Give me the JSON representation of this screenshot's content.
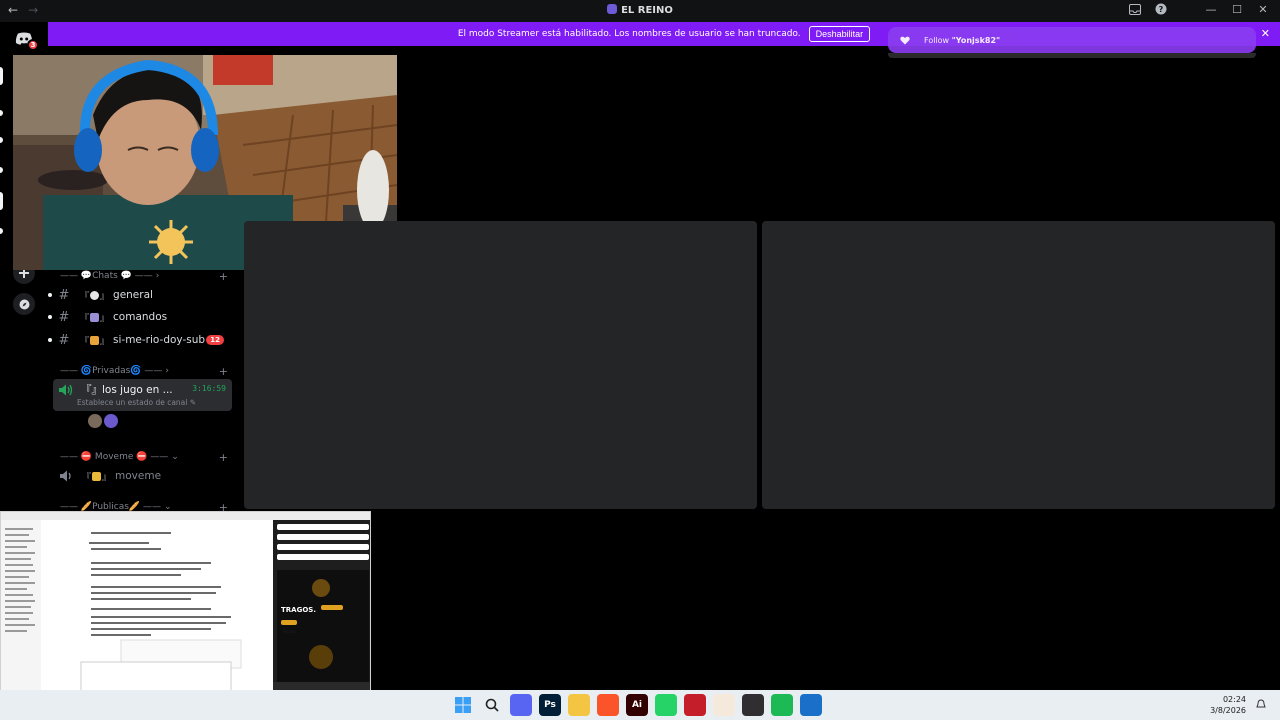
{
  "window": {
    "title": "EL REINO",
    "back_arrow": "←",
    "forward_arrow": "→",
    "minimize": "—",
    "maximize": "☐",
    "close": "✕"
  },
  "rail": {
    "notification_count": "3"
  },
  "banner": {
    "text": "El modo Streamer está habilitado. Los nombres de usuario se han truncado.",
    "button_label": "Deshabilitar",
    "close": "✕"
  },
  "toast": {
    "prefix": "Follow",
    "user": "\"Yonjsk82\""
  },
  "channels": {
    "categories": [
      {
        "label": "—— 💬Chats 💬 ——",
        "chevron": "›"
      },
      {
        "label": "—— 🌀Privadas🌀 ——",
        "chevron": "›"
      },
      {
        "label": "—— ⛔ Moveme ⛔ ——",
        "chevron": "⌄"
      },
      {
        "label": "—— 🥖Publicas🥖 ——",
        "chevron": "⌄"
      }
    ],
    "text_channels": [
      {
        "name": "general",
        "open": "『",
        "close": "』"
      },
      {
        "name": "comandos",
        "open": "『",
        "close": "』"
      },
      {
        "name": "si-me-rio-doy-sub",
        "open": "『",
        "close": "』",
        "mentions": "12"
      }
    ],
    "voice_active": {
      "name": "los jugo en ...",
      "open": "『",
      "close": "』",
      "timer": "3:16:59",
      "status": "Establece un estado de canal ✎"
    },
    "voice_moveme": {
      "name": "moveme",
      "open": "『",
      "close": "』"
    },
    "plus": "+"
  },
  "screen_capture": {
    "heading": "TRAGOS.",
    "promo_tag": "Promo"
  },
  "taskbar": {
    "time": "02:24",
    "date": "3/8/2026",
    "apps": [
      {
        "name": "windows-start",
        "label": "",
        "color": "#1f7ae0"
      },
      {
        "name": "search",
        "label": "",
        "color": "#e9eef2"
      },
      {
        "name": "discord",
        "label": "",
        "color": "#5865f2"
      },
      {
        "name": "photoshop",
        "label": "Ps",
        "color": "#001e36"
      },
      {
        "name": "file-explorer",
        "label": "",
        "color": "#f4c542"
      },
      {
        "name": "brave",
        "label": "",
        "color": "#fb542b"
      },
      {
        "name": "illustrator",
        "label": "Ai",
        "color": "#330000"
      },
      {
        "name": "whatsapp",
        "label": "",
        "color": "#25d366"
      },
      {
        "name": "video-editor",
        "label": "",
        "color": "#c41e2a"
      },
      {
        "name": "sun-app",
        "label": "",
        "color": "#f5e9dc"
      },
      {
        "name": "obs",
        "label": "",
        "color": "#302e31"
      },
      {
        "name": "spotify",
        "label": "",
        "color": "#1db954"
      },
      {
        "name": "shield-app",
        "label": "",
        "color": "#1a6fc9"
      }
    ]
  }
}
